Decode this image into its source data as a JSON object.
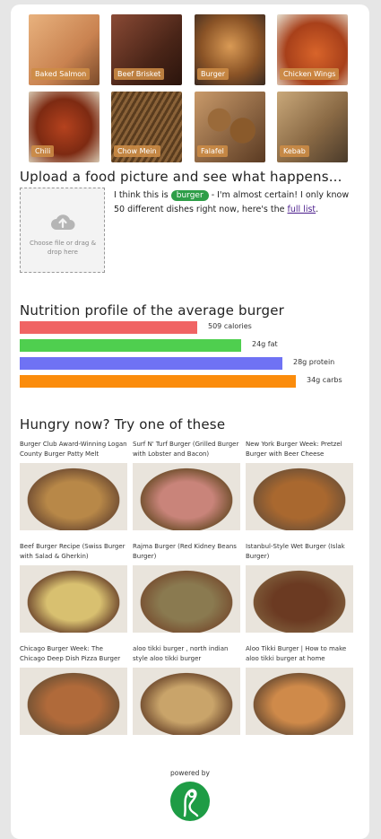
{
  "gallery": [
    {
      "label": "Baked Salmon",
      "color": "#d49a6a"
    },
    {
      "label": "Beef Brisket",
      "color": "#6b3b2a"
    },
    {
      "label": "Burger",
      "color": "#a8612b"
    },
    {
      "label": "Chicken Wings",
      "color": "#b8521e"
    },
    {
      "label": "Chili",
      "color": "#9d3b1c"
    },
    {
      "label": "Chow Mein",
      "color": "#7a5a35"
    },
    {
      "label": "Falafel",
      "color": "#8b5a2b"
    },
    {
      "label": "Kebab",
      "color": "#9e7a55"
    }
  ],
  "upload": {
    "heading": "Upload a food picture and see what happens...",
    "hint": "Choose file or drag & drop here",
    "prefix": "I think this is",
    "tag": "burger",
    "suffix": "- I'm almost certain! I only know 50 different dishes right now, here's the",
    "link": "full list",
    "end": "."
  },
  "nutrition": {
    "heading": "Nutrition profile of the average burger",
    "items": [
      {
        "label": "509 calories",
        "color": "#f06464",
        "fill": 0.52
      },
      {
        "label": "24g fat",
        "color": "#4fcf4f",
        "fill": 0.65
      },
      {
        "label": "28g protein",
        "color": "#6f72f4",
        "fill": 0.77
      },
      {
        "label": "34g carbs",
        "color": "#fb8c0c",
        "fill": 0.81
      }
    ]
  },
  "recipes": {
    "heading": "Hungry now? Try one of these",
    "items": [
      {
        "title": "Burger Club Award-Winning Logan County Burger Patty Melt",
        "color": "#b88848"
      },
      {
        "title": "Surf N' Turf Burger (Grilled Burger with Lobster and Bacon)",
        "color": "#c9847a"
      },
      {
        "title": "New York Burger Week: Pretzel Burger with Beer Cheese",
        "color": "#a9682f"
      },
      {
        "title": "Beef Burger Recipe (Swiss Burger with Salad & Gherkin)",
        "color": "#d8c070"
      },
      {
        "title": "Rajma Burger (Red Kidney Beans Burger)",
        "color": "#8a7a50"
      },
      {
        "title": "Istanbul-Style Wet Burger (Islak Burger)",
        "color": "#6b3a22"
      },
      {
        "title": "Chicago Burger Week: The Chicago Deep Dish Pizza Burger",
        "color": "#b06a3a"
      },
      {
        "title": "aloo tikki burger , north indian style aloo tikki burger",
        "color": "#c9a46a"
      },
      {
        "title": "Aloo Tikki Burger | How to make aloo tikki burger at home",
        "color": "#cf8a4a"
      }
    ]
  },
  "footer": {
    "powered": "powered by"
  }
}
